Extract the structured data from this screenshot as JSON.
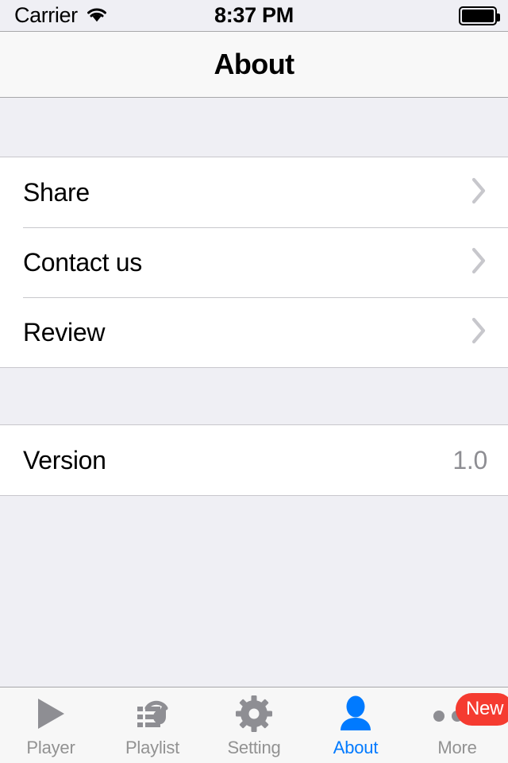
{
  "status_bar": {
    "carrier": "Carrier",
    "wifi_icon": "wifi-icon",
    "time": "8:37 PM",
    "battery_icon": "battery-full-icon"
  },
  "nav_bar": {
    "title": "About"
  },
  "sections": [
    {
      "rows": [
        {
          "label": "Share",
          "accessory": "chevron-right-icon",
          "name": "share"
        },
        {
          "label": "Contact us",
          "accessory": "chevron-right-icon",
          "name": "contact-us"
        },
        {
          "label": "Review",
          "accessory": "chevron-right-icon",
          "name": "review"
        }
      ]
    },
    {
      "rows": [
        {
          "label": "Version",
          "detail": "1.0",
          "accessory": "none",
          "name": "version"
        }
      ]
    }
  ],
  "tab_bar": {
    "items": [
      {
        "label": "Player",
        "icon": "play-triangle-icon",
        "active": false
      },
      {
        "label": "Playlist",
        "icon": "headphones-list-icon",
        "active": false
      },
      {
        "label": "Setting",
        "icon": "gear-icon",
        "active": false
      },
      {
        "label": "About",
        "icon": "person-icon",
        "active": true
      },
      {
        "label": "More",
        "icon": "ellipsis-icon",
        "active": false,
        "badge": "New"
      }
    ]
  },
  "colors": {
    "accent": "#007AFF",
    "badge": "#F53B30",
    "inactive_tab": "#929292",
    "group_background": "#EFEFF4",
    "cell_background": "#FFFFFF",
    "separator": "#C8C7CC",
    "detail_text": "#8E8E93"
  }
}
